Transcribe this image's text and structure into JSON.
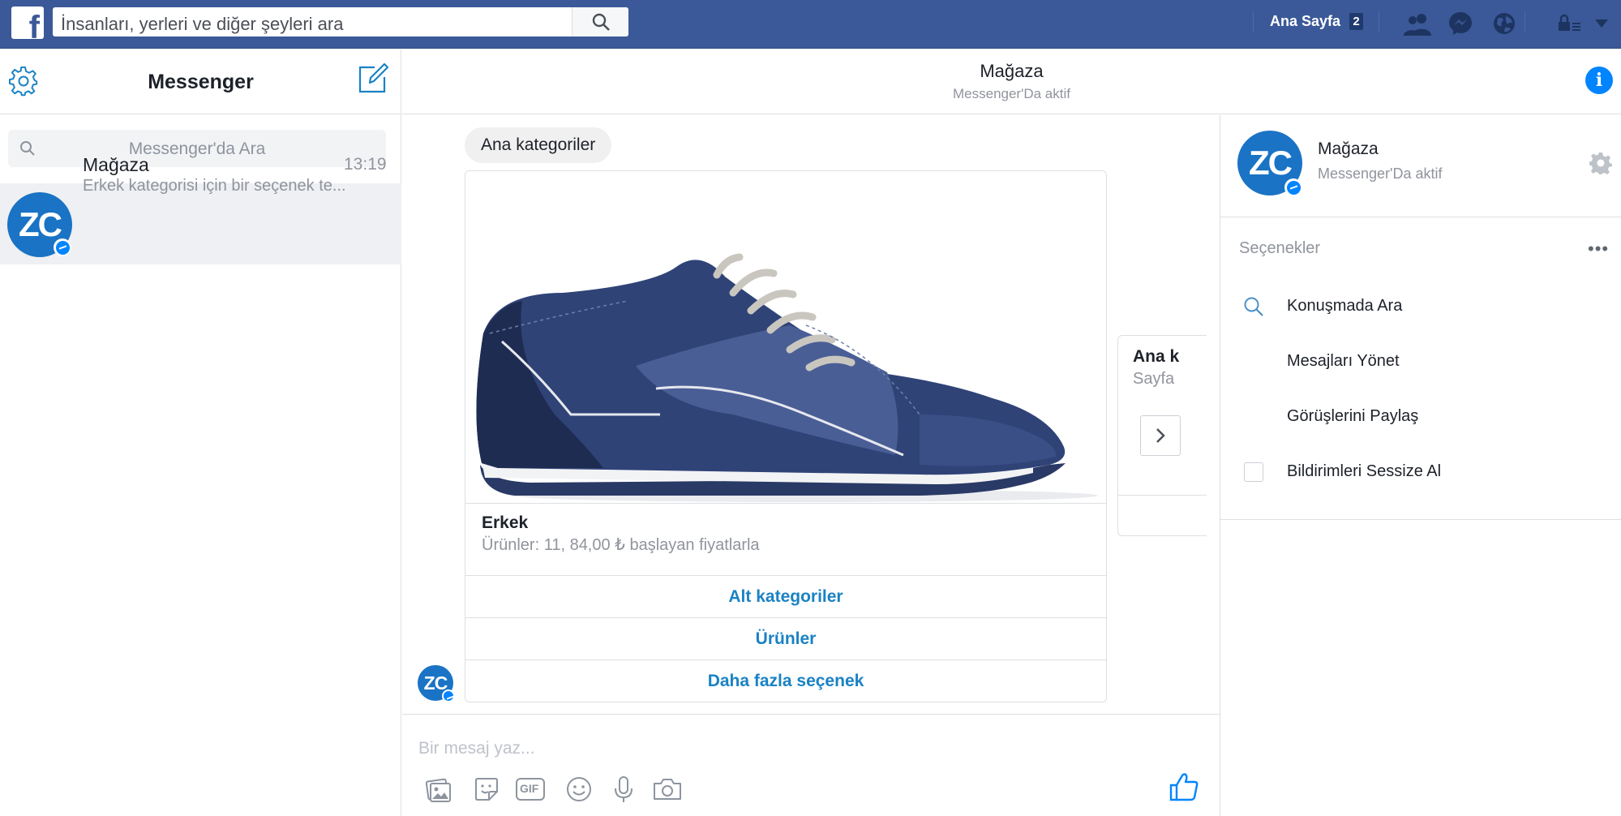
{
  "topbar": {
    "logo_letter": "f",
    "search_placeholder": "İnsanları, yerleri ve diğer şeyleri ara",
    "home_label": "Ana Sayfa",
    "home_badge": "2"
  },
  "left": {
    "title": "Messenger",
    "search_placeholder": "Messenger'da Ara",
    "conversations": [
      {
        "avatar_text": "ZC",
        "name": "Mağaza",
        "time": "13:19",
        "snippet": "Erkek kategorisi için bir seçenek te..."
      }
    ]
  },
  "chat": {
    "title": "Mağaza",
    "subtitle": "Messenger'Da aktif",
    "bubble_text": "Ana kategoriler",
    "avatar_text": "ZC",
    "card": {
      "title": "Erkek",
      "subtitle": "Ürünler: 11, 84,00 ₺ başlayan fiyatlarla",
      "buttons": [
        "Alt kategoriler",
        "Ürünler",
        "Daha fazla seçenek"
      ]
    },
    "next_card": {
      "title": "Ana k",
      "subtitle": "Sayfa"
    },
    "composer_placeholder": "Bir mesaj yaz...",
    "gif_label": "GIF"
  },
  "right": {
    "avatar_text": "ZC",
    "name": "Mağaza",
    "subtitle": "Messenger'Da aktif",
    "section_title": "Seçenekler",
    "more_label": "•••",
    "items": [
      "Konuşmada Ara",
      "Mesajları Yönet",
      "Görüşlerini Paylaş",
      "Bildirimleri Sessize Al"
    ]
  },
  "colors": {
    "facebook_blue": "#3b5998",
    "messenger_blue": "#0084ff",
    "link_blue": "#1a82c4",
    "avatar_blue": "#1a73c4",
    "shoe_navy": "#2b3d6e"
  },
  "icons": [
    "facebook-logo-icon",
    "search-icon",
    "friend-requests-icon",
    "messenger-icon",
    "globe-icon",
    "privacy-icon",
    "dropdown-icon",
    "gear-icon",
    "compose-icon",
    "info-icon",
    "chevron-right-icon",
    "image-icon",
    "sticker-icon",
    "gif-icon",
    "emoji-icon",
    "microphone-icon",
    "camera-icon",
    "thumbs-up-icon",
    "checkbox-icon"
  ]
}
